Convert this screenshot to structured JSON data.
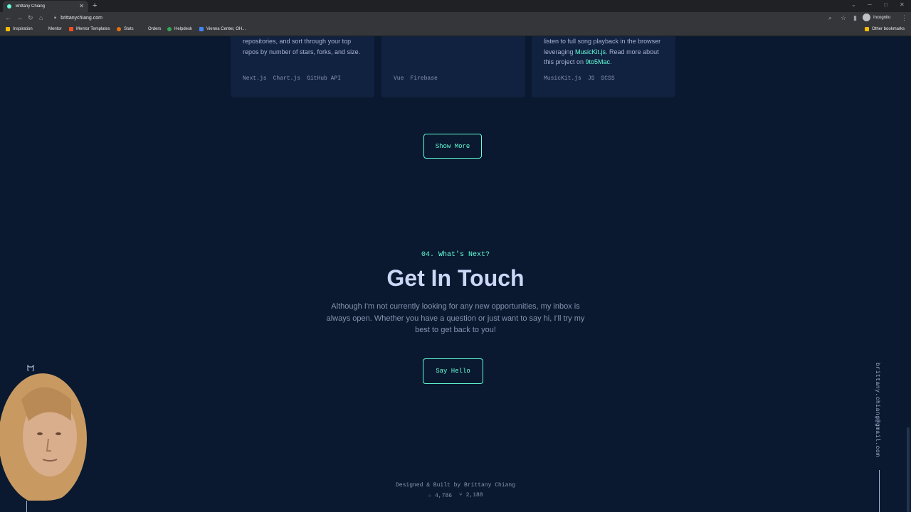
{
  "browser": {
    "tab_title": "Brittany Chiang",
    "url": "brittanychiang.com",
    "incognito_label": "Incognito",
    "bookmarks": [
      "Inspiration",
      "Mentor",
      "Mentor Templates",
      "Stats",
      "Orders",
      "Helpdesk",
      "Vienna Center, OH...",
      "Other bookmarks"
    ]
  },
  "projects": [
    {
      "desc": "repositories, and sort through your top repos by number of stars, forks, and size.",
      "tech": [
        "Next.js",
        "Chart.js",
        "GitHub API"
      ]
    },
    {
      "desc": "",
      "tech": [
        "Vue",
        "Firebase"
      ]
    },
    {
      "desc_1": "listen to full song playback in the browser leveraging ",
      "link_1": "MusicKit.js",
      "desc_2": ". Read more about this project on ",
      "link_2": "9to5Mac",
      "desc_3": ".",
      "tech": [
        "MusicKit.js",
        "JS",
        "SCSS"
      ]
    }
  ],
  "show_more_label": "Show More",
  "contact": {
    "overline": "04. What's Next?",
    "title": "Get In Touch",
    "text": "Although I'm not currently looking for any new opportunities, my inbox is always open. Whether you have a question or just want to say hi, I'll try my best to get back to you!",
    "button": "Say Hello"
  },
  "email": "brittany.chiang@gmail.com",
  "footer": {
    "credit": "Designed & Built by Brittany Chiang",
    "stars": "4,786",
    "forks": "2,188"
  },
  "colors": {
    "background": "#0a192f",
    "card": "#112240",
    "accent": "#64ffda",
    "heading": "#ccd6f6",
    "text": "#8892b0"
  },
  "icons": [
    "github-icon",
    "star-icon",
    "fork-icon"
  ]
}
